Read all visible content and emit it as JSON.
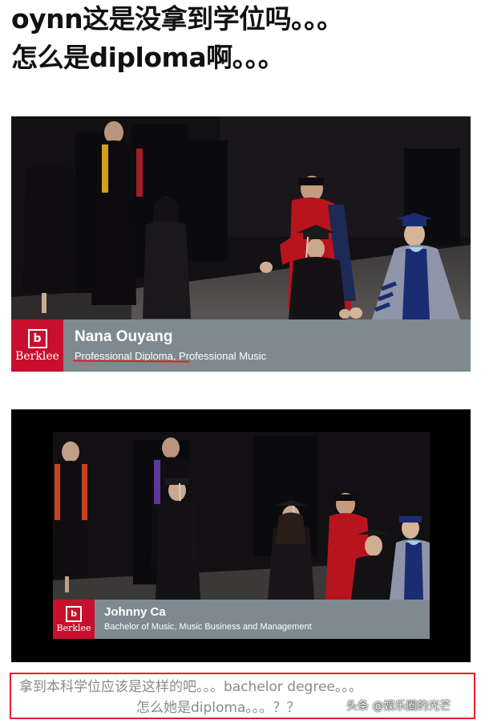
{
  "headline": {
    "line1": "oynn这是没拿到学位吗。。。",
    "line2": "怎么是diploma啊。。。"
  },
  "photo1": {
    "logo_text": "Berklee",
    "name": "Nana Ouyang",
    "degree": "Professional Diploma, Professional Music",
    "logo_color": "#c8102e",
    "bar_color": "#7e8a8f",
    "underline_color": "#e5202a"
  },
  "photo2": {
    "logo_text": "Berklee",
    "name": "Johnny Ca",
    "degree": "Bachelor of Music, Music Business and Management",
    "logo_color": "#c8102e",
    "bar_color": "#7e8a8f"
  },
  "caption": {
    "line1": "拿到本科学位应该是这样的吧。。。bachelor degree。。。",
    "line2": "怎么她是diploma。。。？？",
    "border_color": "#e5202a"
  },
  "watermark": {
    "text": "头条 @娱乐圈的光芒"
  }
}
